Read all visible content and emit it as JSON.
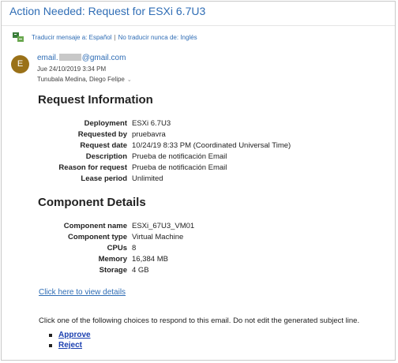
{
  "email": {
    "subject": "Action Needed: Request for ESXi 6.7U3",
    "translate_bar": {
      "translate_link": "Traducir mensaje a: Español",
      "separator": "|",
      "never_translate_link": "No traducir nunca de: Inglés"
    },
    "sender": {
      "avatar_initial": "E",
      "address_prefix": "email.",
      "address_suffix": "@gmail.com",
      "datetime": "Jue 24/10/2019 3:34 PM",
      "recipient": "Tunubala Medina, Diego Felipe"
    }
  },
  "request_information": {
    "heading": "Request Information",
    "rows": [
      {
        "label": "Deployment",
        "value": "ESXi 6.7U3"
      },
      {
        "label": "Requested by",
        "value": "pruebavra"
      },
      {
        "label": "Request date",
        "value": "10/24/19 8:33 PM (Coordinated Universal Time)"
      },
      {
        "label": "Description",
        "value": "Prueba de notificación Email"
      },
      {
        "label": "Reason for request",
        "value": "Prueba de notificación Email"
      },
      {
        "label": "Lease period",
        "value": "Unlimited"
      }
    ]
  },
  "component_details": {
    "heading": "Component Details",
    "rows": [
      {
        "label": "Component name",
        "value": "ESXi_67U3_VM01"
      },
      {
        "label": "Component type",
        "value": "Virtual Machine"
      },
      {
        "label": "CPUs",
        "value": "8"
      },
      {
        "label": "Memory",
        "value": "16,384 MB"
      },
      {
        "label": "Storage",
        "value": "4 GB"
      }
    ]
  },
  "details_link": "Click here to view details",
  "instructions": "Click one of the following choices to respond to this email. Do not edit the generated subject line.",
  "choices": [
    "Approve",
    "Reject"
  ],
  "colors": {
    "link": "#2f6db5",
    "avatar": "#9a7118",
    "action_link": "#1a3fb0"
  },
  "icons": {
    "translate": "translate-icon",
    "expand": "chevron-down-icon"
  }
}
